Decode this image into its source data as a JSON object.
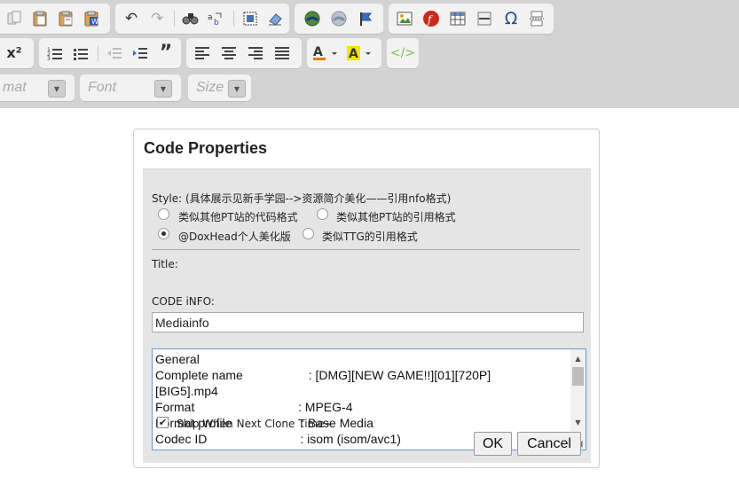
{
  "toolbar": {
    "row1": {
      "clipboard": [
        "copy-icon",
        "paste-icon",
        "paste-text-icon",
        "paste-word-icon"
      ],
      "history": [
        "undo-icon",
        "redo-icon"
      ],
      "find": [
        "find-icon",
        "replace-icon",
        "select-all-icon",
        "remove-format-icon"
      ],
      "links": [
        "link-icon",
        "unlink-icon",
        "anchor-icon"
      ],
      "insert": [
        "image-icon",
        "flash-icon",
        "table-icon",
        "horizontal-rule-icon",
        "special-char-icon",
        "page-break-icon"
      ],
      "omega_glyph": "Ω"
    },
    "row2": {
      "superscript_label": "x²",
      "lists": [
        "numbered-list-icon",
        "bulleted-list-icon"
      ],
      "indent": [
        "outdent-icon",
        "indent-icon",
        "blockquote-icon"
      ],
      "align": [
        "align-left-icon",
        "align-center-icon",
        "align-right-icon",
        "align-justify-icon"
      ],
      "color": [
        "text-color-icon",
        "background-color-icon"
      ],
      "source": [
        "source-code-icon"
      ]
    },
    "row3": {
      "format_placeholder": "mat",
      "font_placeholder": "Font",
      "size_placeholder": "Size"
    }
  },
  "dialog": {
    "title": "Code Properties",
    "style_label": "Style: (具体展示见新手学园-->资源简介美化——引用nfo格式)",
    "radios": [
      {
        "label": "类似其他PT站的代码格式",
        "checked": false
      },
      {
        "label": "类似其他PT站的引用格式",
        "checked": false
      },
      {
        "label": "@DoxHead个人美化版",
        "checked": true
      },
      {
        "label": "类似TTG的引用格式",
        "checked": false
      }
    ],
    "title_label": "Title:",
    "title_value": "Mediainfo",
    "code_label": "CODE iNFO:",
    "code_lines": [
      "General",
      "Complete name                   : [DMG][NEW GAME!!][01][720P]",
      "[BIG5].mp4",
      "Format                              : MPEG-4",
      "Format profile                    : Base Media",
      "Codec ID                           : isom (isom/avc1)"
    ],
    "skip_label": "Skip When Next Clone Time~",
    "skip_checked": true,
    "ok_label": "OK",
    "cancel_label": "Cancel"
  }
}
